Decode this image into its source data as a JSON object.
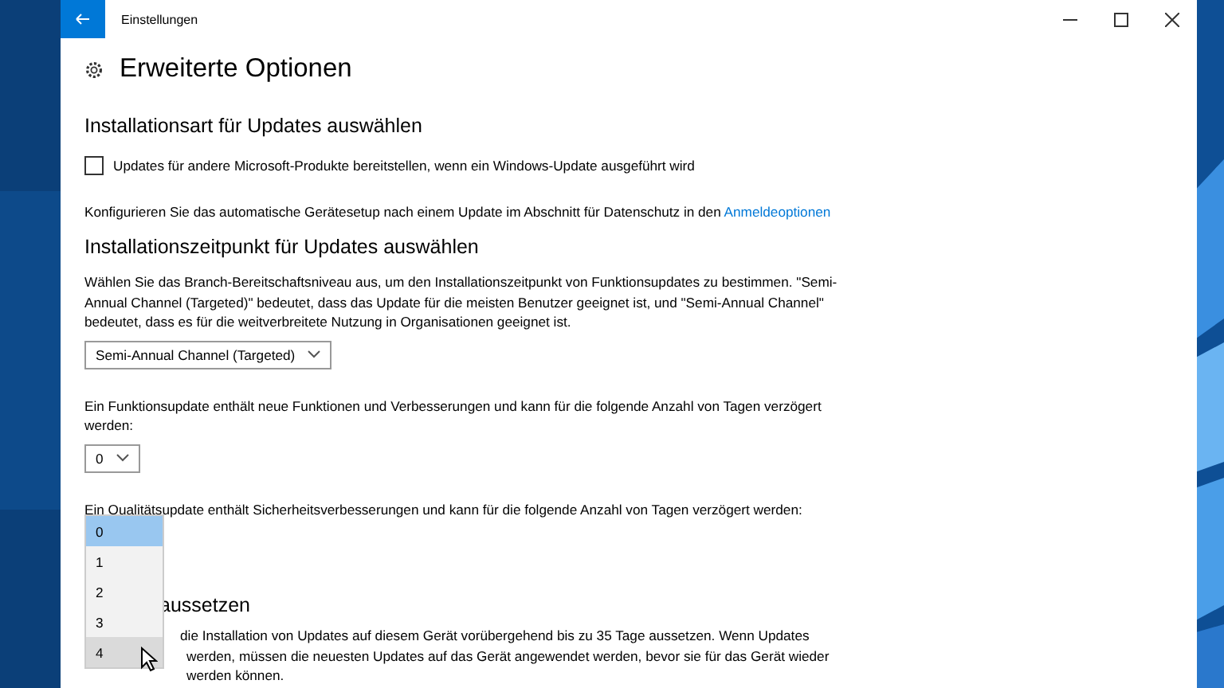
{
  "window": {
    "title": "Einstellungen"
  },
  "page": {
    "title": "Erweiterte Optionen"
  },
  "install_type": {
    "heading": "Installationsart für Updates auswählen",
    "checkbox": {
      "label": "Updates für andere Microsoft-Produkte bereitstellen, wenn ein Windows-Update ausgeführt wird",
      "checked": false
    },
    "note": {
      "text": "Konfigurieren Sie das automatische Gerätesetup nach einem Update im Abschnitt für Datenschutz in den",
      "link": "Anmeldeoptionen"
    }
  },
  "install_time": {
    "heading": "Installationszeitpunkt für Updates auswählen",
    "description": "Wählen Sie das Branch-Bereitschaftsniveau aus, um den Installationszeitpunkt von Funktionsupdates zu bestimmen. \"Semi-Annual Channel (Targeted)\" bedeutet, dass das Update für die meisten Benutzer geeignet ist, und \"Semi-Annual Channel\" bedeutet, dass es für die weitverbreitete Nutzung in Organisationen geeignet ist.",
    "branch_select": {
      "value": "Semi-Annual Channel (Targeted)"
    },
    "feature_text": "Ein Funktionsupdate enthält neue Funktionen und Verbesserungen und kann für die folgende Anzahl von Tagen verzögert werden:",
    "feature_select": {
      "value": "0"
    },
    "quality_text": "Ein Qualitätsupdate enthält Sicherheitsverbesserungen und kann für die folgende Anzahl von Tagen verzögert werden:",
    "quality_dropdown": {
      "options": [
        {
          "label": "0",
          "selected": true,
          "hovered": false
        },
        {
          "label": "1",
          "selected": false,
          "hovered": false
        },
        {
          "label": "2",
          "selected": false,
          "hovered": false
        },
        {
          "label": "3",
          "selected": false,
          "hovered": false
        },
        {
          "label": "4",
          "selected": false,
          "hovered": true
        }
      ]
    }
  },
  "pause": {
    "heading": "aussetzen",
    "lines": [
      "die Installation von Updates auf diesem Gerät vorübergehend bis zu 35 Tage aussetzen. Wenn Updates",
      "werden, müssen die neuesten Updates auf das Gerät angewendet werden, bevor sie für das Gerät wieder",
      "werden können."
    ]
  }
}
